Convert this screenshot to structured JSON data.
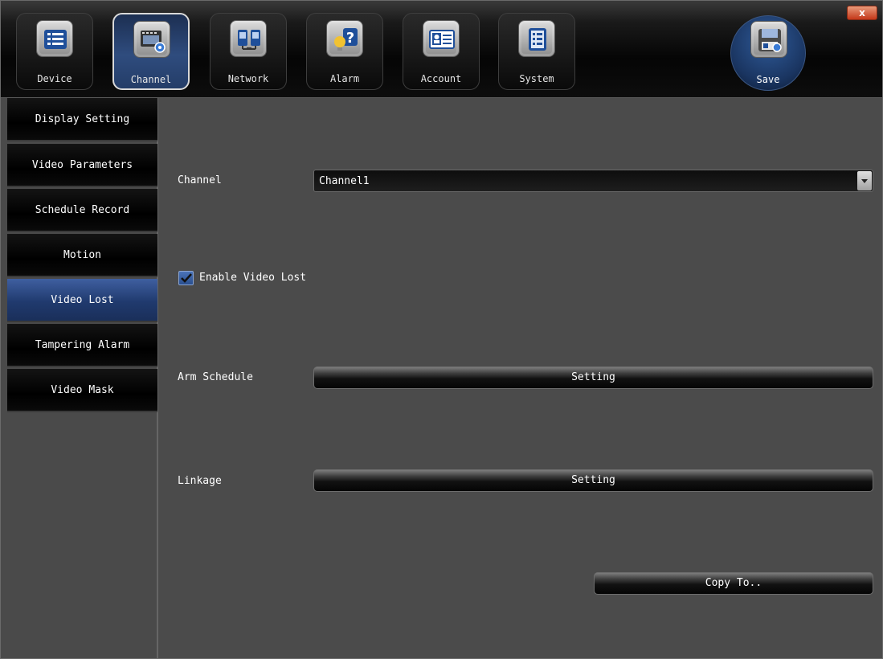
{
  "toolbar": {
    "tabs": [
      {
        "label": "Device",
        "icon": "device-icon"
      },
      {
        "label": "Channel",
        "icon": "channel-icon"
      },
      {
        "label": "Network",
        "icon": "network-icon"
      },
      {
        "label": "Alarm",
        "icon": "alarm-icon"
      },
      {
        "label": "Account",
        "icon": "account-icon"
      },
      {
        "label": "System",
        "icon": "system-icon"
      }
    ],
    "active_tab": "Channel",
    "save_label": "Save",
    "close_glyph": "x"
  },
  "sidebar": {
    "items": [
      {
        "label": "Display Setting"
      },
      {
        "label": "Video Parameters"
      },
      {
        "label": "Schedule Record"
      },
      {
        "label": "Motion"
      },
      {
        "label": "Video Lost"
      },
      {
        "label": "Tampering Alarm"
      },
      {
        "label": "Video Mask"
      }
    ],
    "active_item": "Video Lost"
  },
  "content": {
    "channel_label": "Channel",
    "channel_value": "Channel1",
    "enable_label": "Enable Video Lost",
    "enable_checked": true,
    "arm_schedule_label": "Arm Schedule",
    "arm_schedule_button": "Setting",
    "linkage_label": "Linkage",
    "linkage_button": "Setting",
    "copy_button": "Copy To.."
  },
  "colors": {
    "accent": "#2f4c7e",
    "background": "#4b4b4b",
    "close": "#c4381a"
  }
}
